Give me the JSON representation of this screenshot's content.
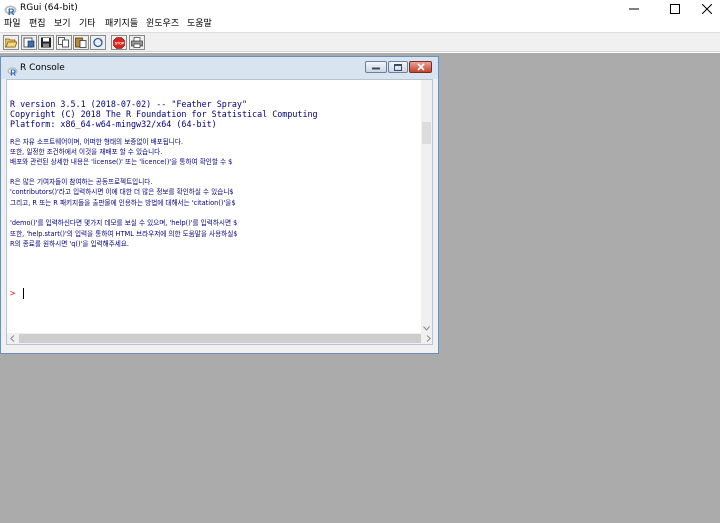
{
  "window": {
    "title": "RGui (64-bit)",
    "controls": [
      "minimize-icon",
      "maximize-icon",
      "close-icon"
    ]
  },
  "menu": [
    {
      "label": "파일"
    },
    {
      "label": "편집"
    },
    {
      "label": "보기"
    },
    {
      "label": "기타"
    },
    {
      "label": "패키지들"
    },
    {
      "label": "윈도우즈"
    },
    {
      "label": "도움말"
    }
  ],
  "toolbar": {
    "buttons": [
      "open-script-icon",
      "load-workspace-icon",
      "save-workspace-icon",
      "copy-icon",
      "paste-icon",
      "copy-paste-icon",
      "stop-icon",
      "print-icon"
    ]
  },
  "console": {
    "title": "R Console",
    "lines": [
      "R version 3.5.1 (2018-07-02) -- \"Feather Spray\"",
      "Copyright (C) 2018 The R Foundation for Statistical Computing",
      "Platform: x86_64-w64-mingw32/x64 (64-bit)",
      "",
      "R은 자유 소프트웨어이며, 어떠한 형태의 보증없이 배포됩니다.",
      "또한, 일정한 조건하에서 이것을 재배포 할 수 있습니다.",
      "배포와 관련된 상세한 내용은 'license()' 또는 'licence()'을 통하여 확인할 수 $",
      "",
      "R은 많은 기여자들이 참여하는 공동프로젝트입니다.",
      "'contributors()'라고 입력하시면 이에 대한 더 많은 정보를 확인하실 수 있습니$",
      "그리고, R 또는 R 패키지들을 출판물에 인용하는 방법에 대해서는 'citation()'을$",
      "",
      "'demo()'를 입력하신다면 몇가지 데모를 보실 수 있으며, 'help()'를 입력하시면 $",
      "또한, 'help.start()'의 입력을 통하여 HTML 브라우저에 의한 도움말을 사용하실$",
      "R의 종료를 원하시면 'q()'을 입력해주세요."
    ],
    "prompt": ">"
  },
  "colors": {
    "console_text": "#000080",
    "prompt": "#ff0000",
    "workspace": "#ababab"
  }
}
